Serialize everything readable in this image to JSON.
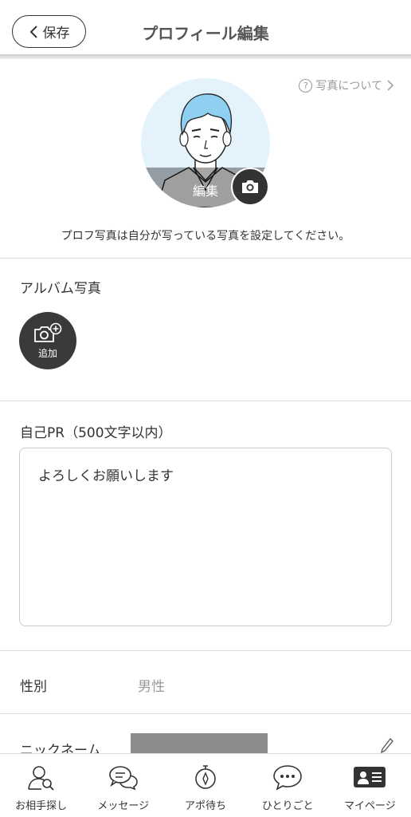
{
  "header": {
    "back_label": "保存",
    "title": "プロフィール編集"
  },
  "photo": {
    "help_link": "写真について",
    "edit_label": "編集",
    "note": "プロフ写真は自分が写っている写真を設定してください。"
  },
  "album": {
    "title": "アルバム写真",
    "add_label": "追加"
  },
  "pr": {
    "title": "自己PR（500文字以内）",
    "value": "よろしくお願いします"
  },
  "fields": {
    "gender_label": "性別",
    "gender_value": "男性",
    "nickname_label": "ニックネーム"
  },
  "tabs": [
    {
      "label": "お相手探し",
      "icon": "search-person-icon"
    },
    {
      "label": "メッセージ",
      "icon": "chat-bubbles-icon"
    },
    {
      "label": "アポ待ち",
      "icon": "stopwatch-icon"
    },
    {
      "label": "ひとりごと",
      "icon": "speech-dots-icon"
    },
    {
      "label": "マイページ",
      "icon": "profile-card-icon"
    }
  ]
}
